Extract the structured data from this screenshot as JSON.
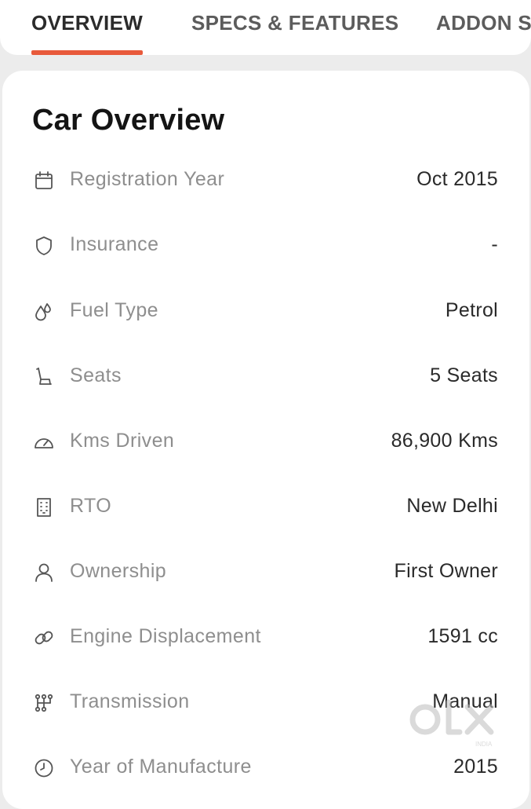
{
  "tabs": [
    {
      "label": "OVERVIEW",
      "active": true
    },
    {
      "label": "SPECS & FEATURES",
      "active": false
    },
    {
      "label": "ADDON S",
      "active": false
    }
  ],
  "card": {
    "title": "Car Overview",
    "rows": [
      {
        "icon": "calendar-icon",
        "label": "Registration Year",
        "value": "Oct 2015"
      },
      {
        "icon": "shield-icon",
        "label": "Insurance",
        "value": "-"
      },
      {
        "icon": "fuel-drops-icon",
        "label": "Fuel Type",
        "value": "Petrol"
      },
      {
        "icon": "seat-icon",
        "label": "Seats",
        "value": "5 Seats"
      },
      {
        "icon": "speedometer-icon",
        "label": "Kms Driven",
        "value": "86,900 Kms"
      },
      {
        "icon": "building-icon",
        "label": "RTO",
        "value": "New Delhi"
      },
      {
        "icon": "user-icon",
        "label": "Ownership",
        "value": "First Owner"
      },
      {
        "icon": "engine-link-icon",
        "label": "Engine Displacement",
        "value": "1591 cc"
      },
      {
        "icon": "gear-shift-icon",
        "label": "Transmission",
        "value": "Manual"
      },
      {
        "icon": "clock-icon",
        "label": "Year of Manufacture",
        "value": "2015"
      }
    ]
  },
  "watermark": {
    "brand": "OLX",
    "sub": "INDIA"
  },
  "colors": {
    "accent": "#e85a3b",
    "label": "#8e8e8e",
    "value": "#2a2a2a",
    "title": "#141414"
  }
}
